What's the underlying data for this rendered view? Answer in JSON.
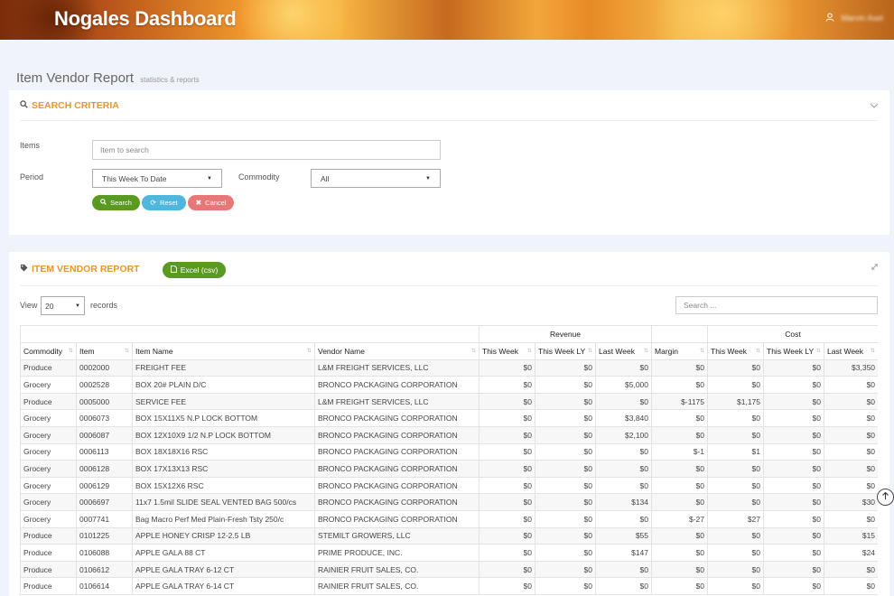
{
  "header": {
    "brand": "Nogales Dashboard",
    "user_name": "Marvin Axel"
  },
  "page": {
    "title": "Item Vendor Report",
    "subtitle": "statistics & reports"
  },
  "search_panel": {
    "title": "SEARCH CRITERIA",
    "items_label": "Items",
    "items_placeholder": "Item to search",
    "period_label": "Period",
    "period_value": "This Week To Date",
    "commodity_label": "Commodity",
    "commodity_value": "All",
    "search_button": "Search",
    "reset_button": "Reset",
    "cancel_button": "Cancel"
  },
  "report_panel": {
    "title": "ITEM VENDOR REPORT",
    "excel_button": "Excel (csv)",
    "view_label": "View",
    "page_size": "20",
    "records_label": "records",
    "search_placeholder": "Search ..."
  },
  "table": {
    "groups": {
      "revenue": "Revenue",
      "cost": "Cost"
    },
    "columns": [
      "Commodity",
      "Item",
      "Item Name",
      "Vendor Name",
      "This Week",
      "This Week LY",
      "Last Week",
      "Margin",
      "This Week",
      "This Week LY",
      "Last Week"
    ],
    "rows": [
      [
        "Produce",
        "0002000",
        "FREIGHT FEE",
        "L&M FREIGHT SERVICES, LLC",
        "$0",
        "$0",
        "$0",
        "$0",
        "$0",
        "$0",
        "$3,350"
      ],
      [
        "Grocery",
        "0002528",
        "BOX 20# PLAIN D/C",
        "BRONCO PACKAGING CORPORATION",
        "$0",
        "$0",
        "$5,000",
        "$0",
        "$0",
        "$0",
        "$0"
      ],
      [
        "Produce",
        "0005000",
        "SERVICE FEE",
        "L&M FREIGHT SERVICES, LLC",
        "$0",
        "$0",
        "$0",
        "$-1175",
        "$1,175",
        "$0",
        "$0"
      ],
      [
        "Grocery",
        "0006073",
        "BOX 15X11X5 N.P LOCK BOTTOM",
        "BRONCO PACKAGING CORPORATION",
        "$0",
        "$0",
        "$3,840",
        "$0",
        "$0",
        "$0",
        "$0"
      ],
      [
        "Grocery",
        "0006087",
        "BOX 12X10X9 1/2 N.P LOCK BOTTOM",
        "BRONCO PACKAGING CORPORATION",
        "$0",
        "$0",
        "$2,100",
        "$0",
        "$0",
        "$0",
        "$0"
      ],
      [
        "Grocery",
        "0006113",
        "BOX 18X18X16 RSC",
        "BRONCO PACKAGING CORPORATION",
        "$0",
        "$0",
        "$0",
        "$-1",
        "$1",
        "$0",
        "$0"
      ],
      [
        "Grocery",
        "0006128",
        "BOX 17X13X13 RSC",
        "BRONCO PACKAGING CORPORATION",
        "$0",
        "$0",
        "$0",
        "$0",
        "$0",
        "$0",
        "$0"
      ],
      [
        "Grocery",
        "0006129",
        "BOX 15X12X6 RSC",
        "BRONCO PACKAGING CORPORATION",
        "$0",
        "$0",
        "$0",
        "$0",
        "$0",
        "$0",
        "$0"
      ],
      [
        "Grocery",
        "0006697",
        "11x7 1.5mil SLIDE SEAL VENTED BAG 500/cs",
        "BRONCO PACKAGING CORPORATION",
        "$0",
        "$0",
        "$134",
        "$0",
        "$0",
        "$0",
        "$30"
      ],
      [
        "Grocery",
        "0007741",
        "Bag Macro Perf Med Plain-Fresh Tsty 250/c",
        "BRONCO PACKAGING CORPORATION",
        "$0",
        "$0",
        "$0",
        "$-27",
        "$27",
        "$0",
        "$0"
      ],
      [
        "Produce",
        "0101225",
        "APPLE HONEY CRISP 12-2.5 LB",
        "STEMILT GROWERS, LLC",
        "$0",
        "$0",
        "$55",
        "$0",
        "$0",
        "$0",
        "$15"
      ],
      [
        "Produce",
        "0106088",
        "APPLE GALA 88 CT",
        "PRIME PRODUCE, INC.",
        "$0",
        "$0",
        "$147",
        "$0",
        "$0",
        "$0",
        "$24"
      ],
      [
        "Produce",
        "0106612",
        "APPLE GALA TRAY 6-12 CT",
        "RAINIER FRUIT SALES, CO.",
        "$0",
        "$0",
        "$0",
        "$0",
        "$0",
        "$0",
        "$0"
      ],
      [
        "Produce",
        "0106614",
        "APPLE GALA TRAY 6-14 CT",
        "RAINIER FRUIT SALES, CO.",
        "$0",
        "$0",
        "$0",
        "$0",
        "$0",
        "$0",
        "$0"
      ]
    ]
  },
  "colors": {
    "accent": "#e4962f",
    "green": "#5a9a23",
    "blue": "#4fb7dd",
    "red": "#e87878"
  }
}
